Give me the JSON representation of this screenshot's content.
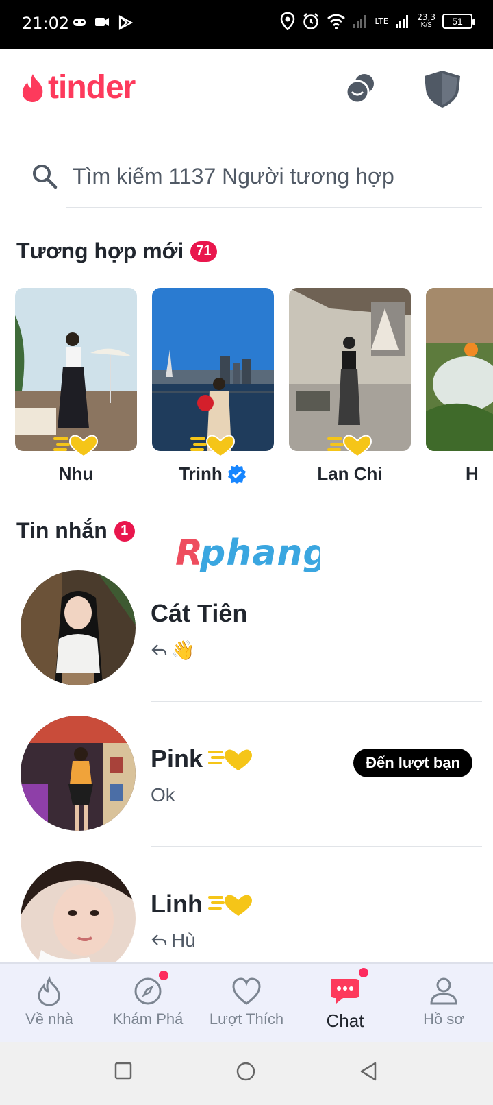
{
  "status_bar": {
    "time": "21:02",
    "network": "LTE",
    "speed_value": "23,3",
    "speed_unit": "K/S",
    "battery": "51"
  },
  "header": {
    "logo_text": "tinder",
    "brand_color": "#fd3a5c"
  },
  "search": {
    "placeholder": "Tìm kiếm 1137 Người tương hợp"
  },
  "new_matches": {
    "title": "Tương hợp mới",
    "count": "71",
    "items": [
      {
        "name": "Nhu",
        "verified": false,
        "super_like": true
      },
      {
        "name": "Trinh",
        "verified": true,
        "super_like": true
      },
      {
        "name": "Lan Chi",
        "verified": false,
        "super_like": true
      },
      {
        "name": "H",
        "verified": false,
        "super_like": false
      }
    ]
  },
  "messages": {
    "title": "Tin nhắn",
    "count": "1",
    "items": [
      {
        "name": "Cát Tiên",
        "preview": "👋",
        "replied": true,
        "super_like": false,
        "badge": ""
      },
      {
        "name": "Pink",
        "preview": "Ok",
        "replied": false,
        "super_like": true,
        "badge": "Đến lượt bạn"
      },
      {
        "name": "Linh",
        "preview": "Hù",
        "replied": true,
        "super_like": true,
        "badge": ""
      }
    ]
  },
  "watermark": "Rphang",
  "bottom_nav": {
    "items": [
      {
        "label": "Về nhà",
        "icon": "flame-icon",
        "active": false,
        "dot": false
      },
      {
        "label": "Khám Phá",
        "icon": "compass-icon",
        "active": false,
        "dot": true
      },
      {
        "label": "Lượt Thích",
        "icon": "heart-icon",
        "active": false,
        "dot": false
      },
      {
        "label": "Chat",
        "icon": "chat-icon",
        "active": true,
        "dot": true
      },
      {
        "label": "Hồ sơ",
        "icon": "profile-icon",
        "active": false,
        "dot": false
      }
    ]
  }
}
